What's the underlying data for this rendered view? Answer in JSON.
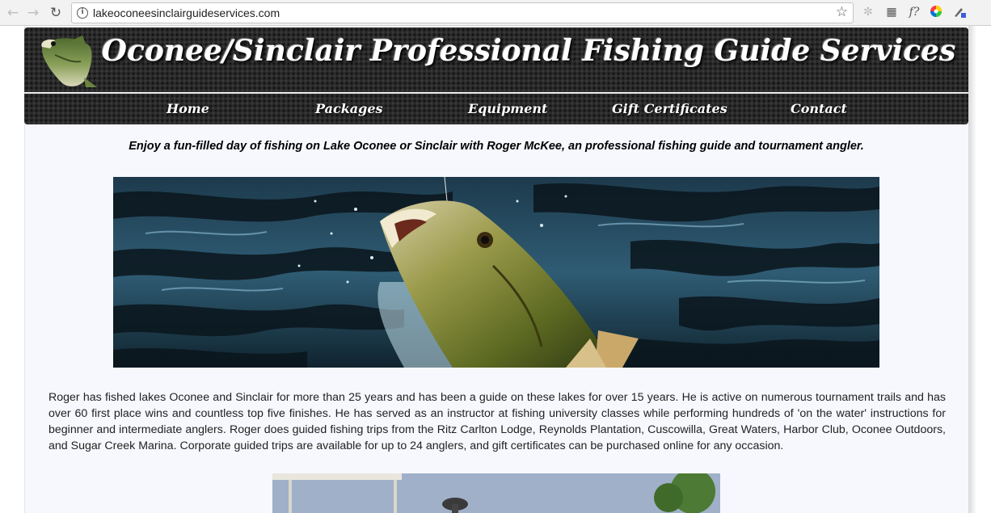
{
  "browser": {
    "url": "lakeoconeesinclairguideservices.com",
    "back_icon": "back-arrow-icon",
    "forward_icon": "forward-arrow-icon",
    "reload_icon": "reload-icon",
    "bookmark_icon": "star-icon"
  },
  "header": {
    "title": "Oconee/Sinclair Professional Fishing Guide Services",
    "logo": "largemouth-bass-logo"
  },
  "nav": {
    "items": [
      {
        "label": "Home"
      },
      {
        "label": "Packages"
      },
      {
        "label": "Equipment"
      },
      {
        "label": "Gift Certificates"
      },
      {
        "label": "Contact"
      }
    ]
  },
  "main": {
    "tagline": "Enjoy a fun-filled day of fishing on Lake Oconee or Sinclair with Roger McKee, an professional fishing guide and tournament angler.",
    "hero_image": "bass-jumping-from-water",
    "bio": "Roger has fished lakes Oconee and Sinclair for more than 25 years and has been a guide on these lakes for over 15 years. He is active on numerous tournament trails and has over 60 first place wins and countless top five finishes. He has served as an instructor at fishing university classes while performing hundreds of 'on the water' instructions for beginner and intermediate anglers. Roger does guided fishing trips from the Ritz Carlton Lodge, Reynolds Plantation, Cuscowilla, Great Waters, Harbor Club, Oconee Outdoors, and Sugar Creek Marina. Corporate guided trips are available for up to 24 anglers, and gift certificates can be purchased online for any occasion.",
    "second_image": "boat-dock-photo"
  },
  "colors": {
    "header_bg": "#2b2b2b",
    "page_bg": "#f7f8fe",
    "text": "#222222"
  }
}
